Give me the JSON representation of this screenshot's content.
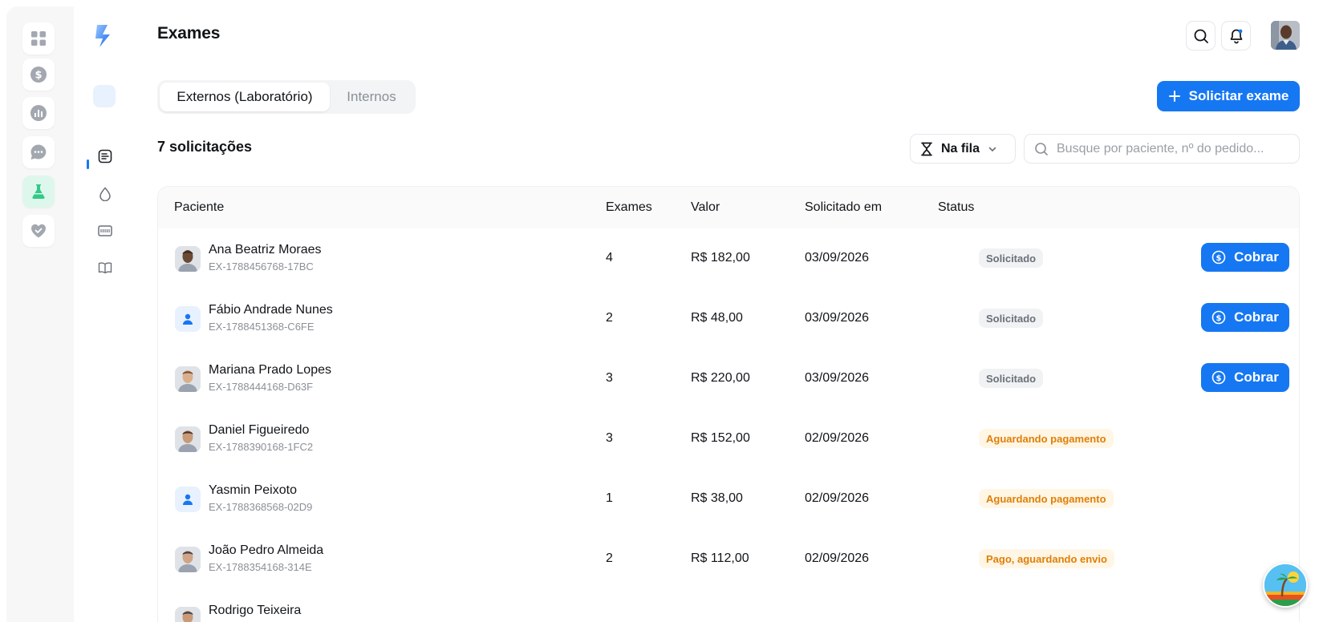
{
  "page": {
    "title": "Exames"
  },
  "tabs": [
    {
      "label": "Externos (Laboratório)",
      "active": true
    },
    {
      "label": "Internos",
      "active": false
    }
  ],
  "actions": {
    "request_exam_label": "Solicitar exame"
  },
  "toolbar": {
    "count_label": "7 solicitações",
    "filter_label": "Na fila",
    "search_placeholder": "Busque por paciente, nº do pedido..."
  },
  "table": {
    "headers": {
      "patient": "Paciente",
      "exams": "Exames",
      "value": "Valor",
      "requested_at": "Solicitado em",
      "status": "Status"
    },
    "rows": [
      {
        "name": "Ana Beatriz Moraes",
        "id": "EX-1788456768-17BC",
        "exams": "4",
        "value": "R$ 182,00",
        "date": "03/09/2026",
        "status": "Solicitado",
        "status_tone": "gray",
        "action": "Cobrar",
        "avatar": "photo"
      },
      {
        "name": "Fábio Andrade Nunes",
        "id": "EX-1788451368-C6FE",
        "exams": "2",
        "value": "R$ 48,00",
        "date": "03/09/2026",
        "status": "Solicitado",
        "status_tone": "gray",
        "action": "Cobrar",
        "avatar": "generic"
      },
      {
        "name": "Mariana Prado Lopes",
        "id": "EX-1788444168-D63F",
        "exams": "3",
        "value": "R$ 220,00",
        "date": "03/09/2026",
        "status": "Solicitado",
        "status_tone": "gray",
        "action": "Cobrar",
        "avatar": "photo"
      },
      {
        "name": "Daniel Figueiredo",
        "id": "EX-1788390168-1FC2",
        "exams": "3",
        "value": "R$ 152,00",
        "date": "02/09/2026",
        "status": "Aguardando pagamento",
        "status_tone": "orange",
        "action": "",
        "avatar": "photo"
      },
      {
        "name": "Yasmin Peixoto",
        "id": "EX-1788368568-02D9",
        "exams": "1",
        "value": "R$ 38,00",
        "date": "02/09/2026",
        "status": "Aguardando pagamento",
        "status_tone": "orange",
        "action": "",
        "avatar": "generic"
      },
      {
        "name": "João Pedro Almeida",
        "id": "EX-1788354168-314E",
        "exams": "2",
        "value": "R$ 112,00",
        "date": "02/09/2026",
        "status": "Pago, aguardando envio",
        "status_tone": "orange",
        "action": "",
        "avatar": "photo"
      },
      {
        "name": "Rodrigo Teixeira",
        "id": "",
        "exams": "",
        "value": "",
        "date": "",
        "status": "",
        "status_tone": "orange",
        "action": "",
        "avatar": "photo"
      }
    ]
  },
  "colors": {
    "accent": "#1677f2",
    "active_rail": "#def7ec",
    "status_gray_bg": "#f1f2f4",
    "status_orange_bg": "#fff6e5",
    "status_orange_text": "#e07f08"
  },
  "icons": {
    "rail": [
      "grid-icon",
      "dollar-icon",
      "chart-icon",
      "chat-icon",
      "flask-icon",
      "heart-icon"
    ],
    "side": [
      "exam-doc-icon",
      "drop-icon",
      "id-card-icon",
      "book-icon"
    ]
  }
}
